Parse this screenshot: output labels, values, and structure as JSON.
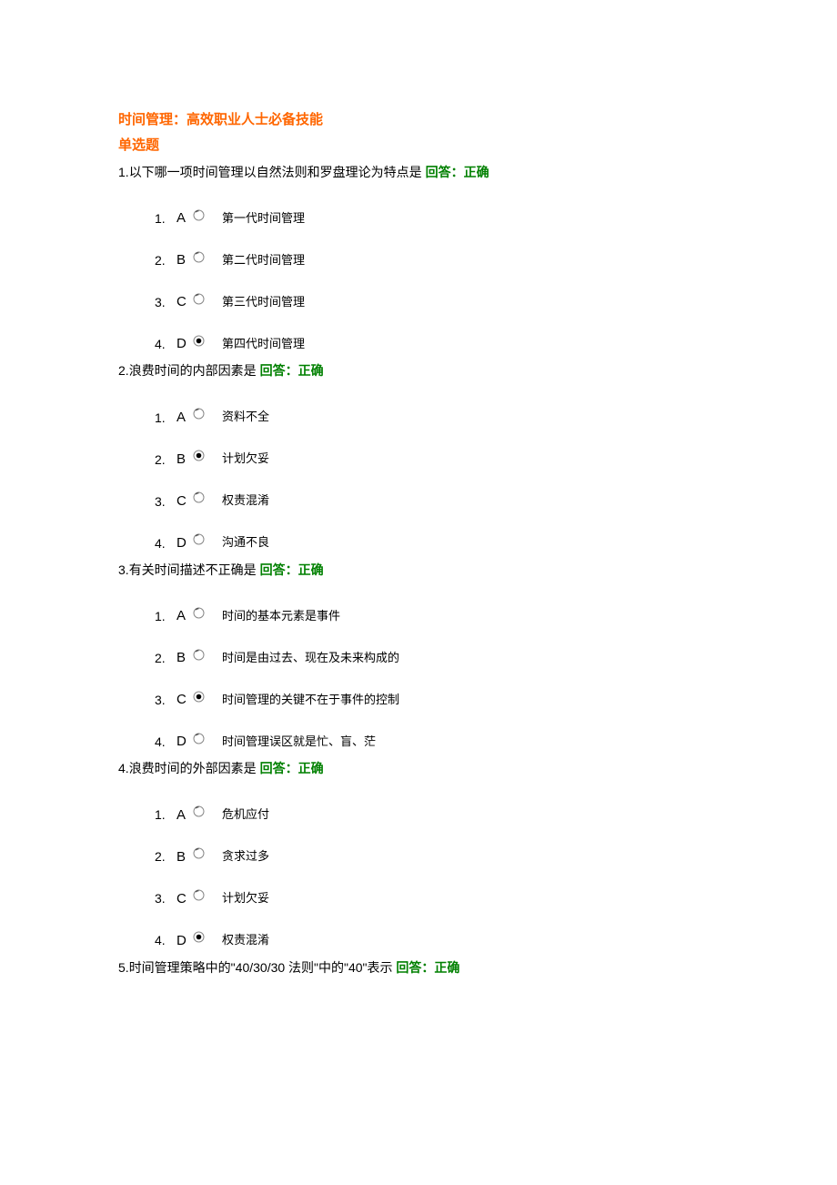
{
  "title": "时间管理：高效职业人士必备技能",
  "subtitle": "单选题",
  "answerPrefix": "回答：正确",
  "questions": [
    {
      "num": "1.",
      "text": "以下哪一项时间管理以自然法则和罗盘理论为特点是",
      "selected": 3,
      "options": [
        {
          "n": "1.",
          "letter": "A",
          "text": "第一代时间管理"
        },
        {
          "n": "2.",
          "letter": "B",
          "text": "第二代时间管理"
        },
        {
          "n": "3.",
          "letter": "C",
          "text": "第三代时间管理"
        },
        {
          "n": "4.",
          "letter": "D",
          "text": "第四代时间管理"
        }
      ]
    },
    {
      "num": "2.",
      "text": "浪费时间的内部因素是",
      "selected": 1,
      "options": [
        {
          "n": "1.",
          "letter": "A",
          "text": "资料不全"
        },
        {
          "n": "2.",
          "letter": "B",
          "text": "计划欠妥"
        },
        {
          "n": "3.",
          "letter": "C",
          "text": "权责混淆"
        },
        {
          "n": "4.",
          "letter": "D",
          "text": "沟通不良"
        }
      ]
    },
    {
      "num": "3.",
      "text": "有关时间描述不正确是",
      "selected": 2,
      "options": [
        {
          "n": "1.",
          "letter": "A",
          "text": "时间的基本元素是事件"
        },
        {
          "n": "2.",
          "letter": "B",
          "text": "时间是由过去、现在及未来构成的"
        },
        {
          "n": "3.",
          "letter": "C",
          "text": "时间管理的关键不在于事件的控制"
        },
        {
          "n": "4.",
          "letter": "D",
          "text": "时间管理误区就是忙、盲、茫"
        }
      ]
    },
    {
      "num": "4.",
      "text": "浪费时间的外部因素是",
      "selected": 3,
      "options": [
        {
          "n": "1.",
          "letter": "A",
          "text": "危机应付"
        },
        {
          "n": "2.",
          "letter": "B",
          "text": "贪求过多"
        },
        {
          "n": "3.",
          "letter": "C",
          "text": "计划欠妥"
        },
        {
          "n": "4.",
          "letter": "D",
          "text": "权责混淆"
        }
      ]
    },
    {
      "num": "5.",
      "text": "时间管理策略中的\"40/30/30 法则\"中的\"40\"表示",
      "selected": -1,
      "options": []
    }
  ]
}
